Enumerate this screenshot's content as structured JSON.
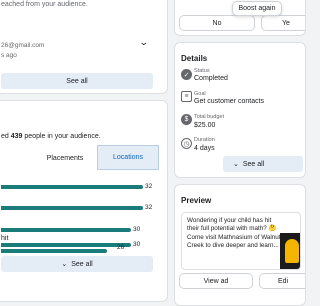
{
  "left_top": {
    "subtitle": "eached from your audience.",
    "email": "26@gmail.com",
    "ago": "s ago",
    "see_all": "See all"
  },
  "audience": {
    "reached_prefix": "ed",
    "reached_count": "439",
    "reached_suffix": "people in your audience.",
    "tabs": [
      {
        "label": "Placements",
        "selected": false
      },
      {
        "label": "Locations",
        "selected": true
      }
    ],
    "rows": [
      {
        "label": "",
        "value": 32
      },
      {
        "label": "",
        "value": 32
      },
      {
        "label": "",
        "value": 30
      },
      {
        "label": "hit",
        "value": 30
      },
      {
        "label": "",
        "value": 26
      }
    ],
    "see_all": "See all"
  },
  "top_buttons": {
    "boost_again": "Boost again",
    "no": "No",
    "yes": "Ye"
  },
  "details": {
    "title": "Details",
    "items": [
      {
        "icon": "status-icon",
        "label": "Status",
        "value": "Completed"
      },
      {
        "icon": "goal-icon",
        "label": "Goal",
        "value": "Get customer contacts"
      },
      {
        "icon": "dollar-icon",
        "label": "Total budget",
        "value": "$25.00"
      },
      {
        "icon": "clock-icon",
        "label": "Duration",
        "value": "4 days"
      }
    ],
    "see_all": "See all"
  },
  "preview": {
    "title": "Preview",
    "ad_text": "Wondering if your child has hit their full potential with math? 🤔 Come visit Mathnasium of Walnut Creek to dive deeper and learn...",
    "view_ad": "View ad",
    "edit": "Edi"
  },
  "colors": {
    "bar": "#1a7d7c",
    "tab_selected": "#e4ecf6",
    "accent_link": "#0a66c2"
  }
}
